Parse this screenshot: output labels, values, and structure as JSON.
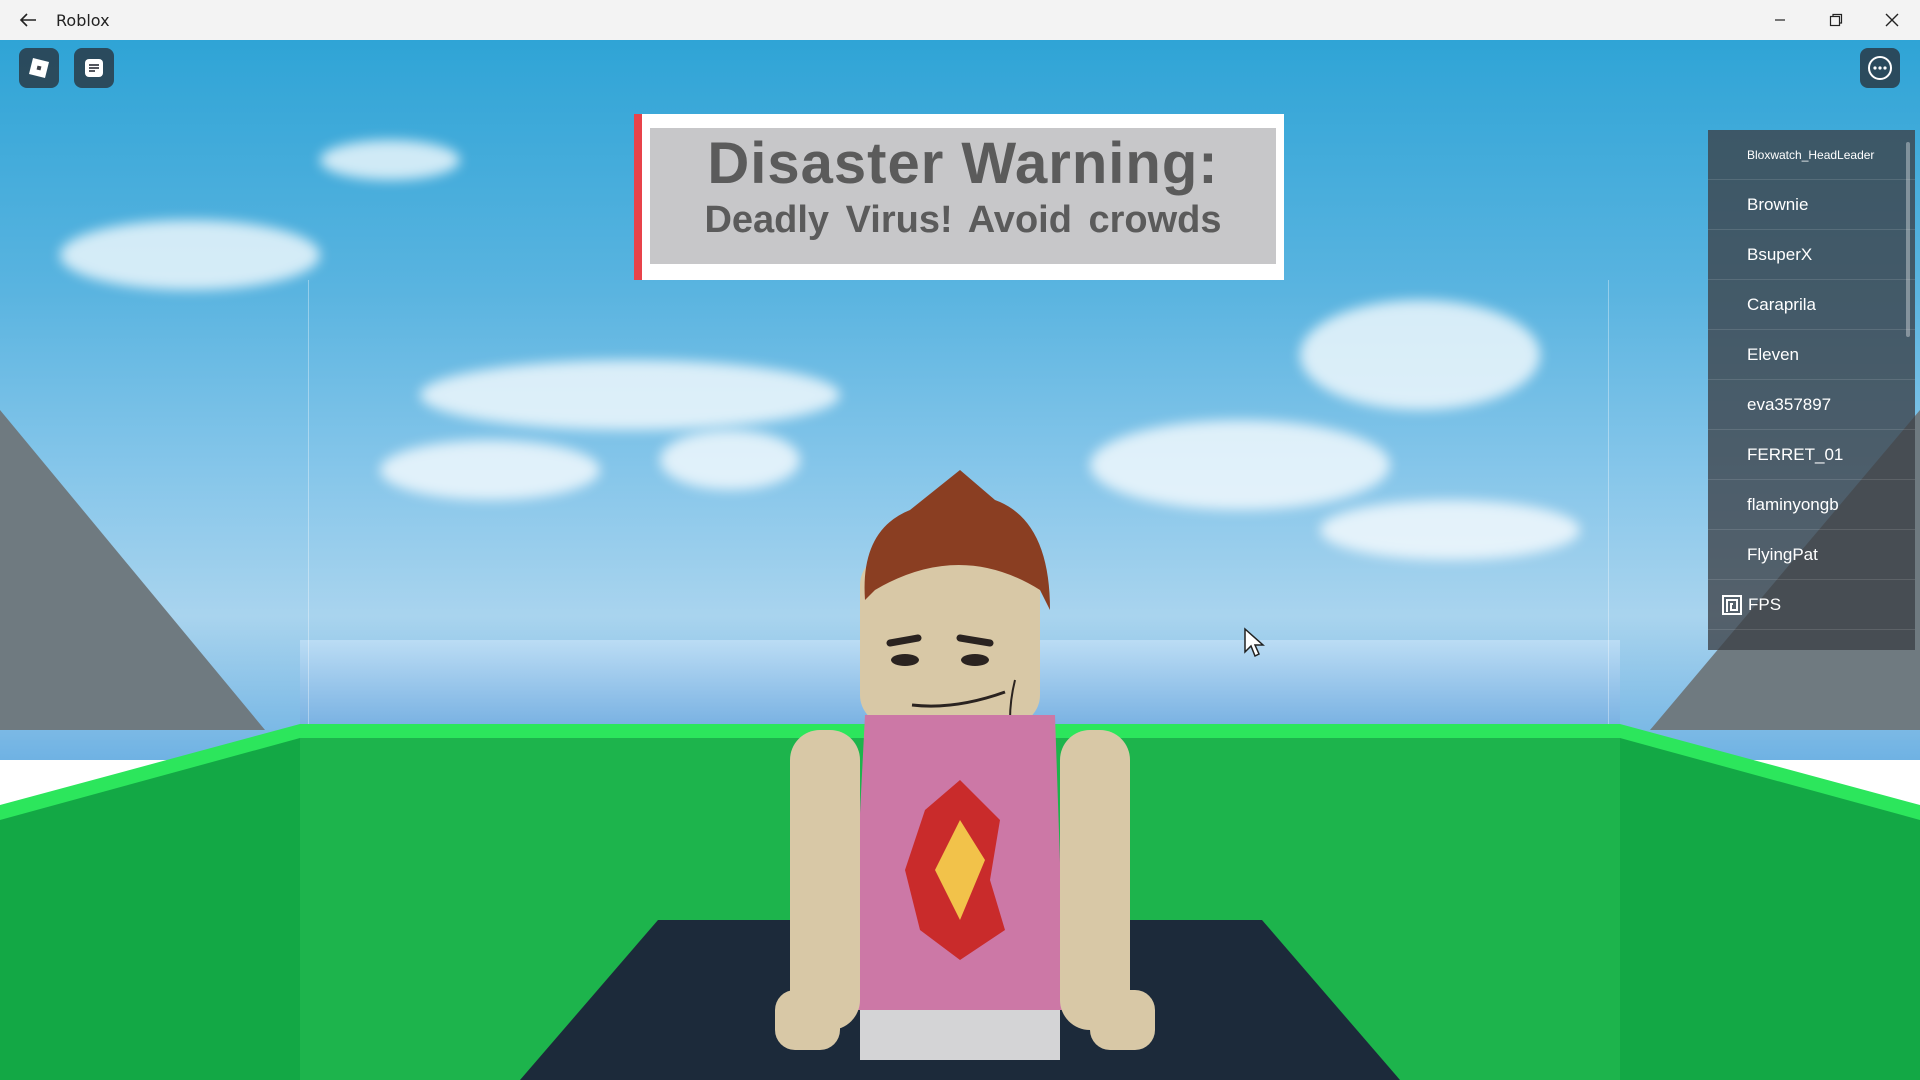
{
  "window": {
    "title": "Roblox",
    "back_icon": "back-arrow-icon",
    "controls": [
      "minimize-icon",
      "restore-icon",
      "close-icon"
    ]
  },
  "hud": {
    "roblox_menu_icon": "roblox-logo-icon",
    "chat_icon": "chat-icon",
    "more_icon": "more-options-icon"
  },
  "banner": {
    "title": "Disaster Warning:",
    "subtitle": "Deadly Virus!  Avoid crowds",
    "accent_color": "#e8434a"
  },
  "player_list": {
    "players": [
      "Bloxwatch_HeadLeader",
      "Brownie",
      "BsuperX",
      "Caraprila",
      "Eleven",
      "eva357897",
      "FERRET_01",
      "flaminyongb",
      "FlyingPat",
      "FPS"
    ],
    "fps_icon": "premium-icon"
  }
}
